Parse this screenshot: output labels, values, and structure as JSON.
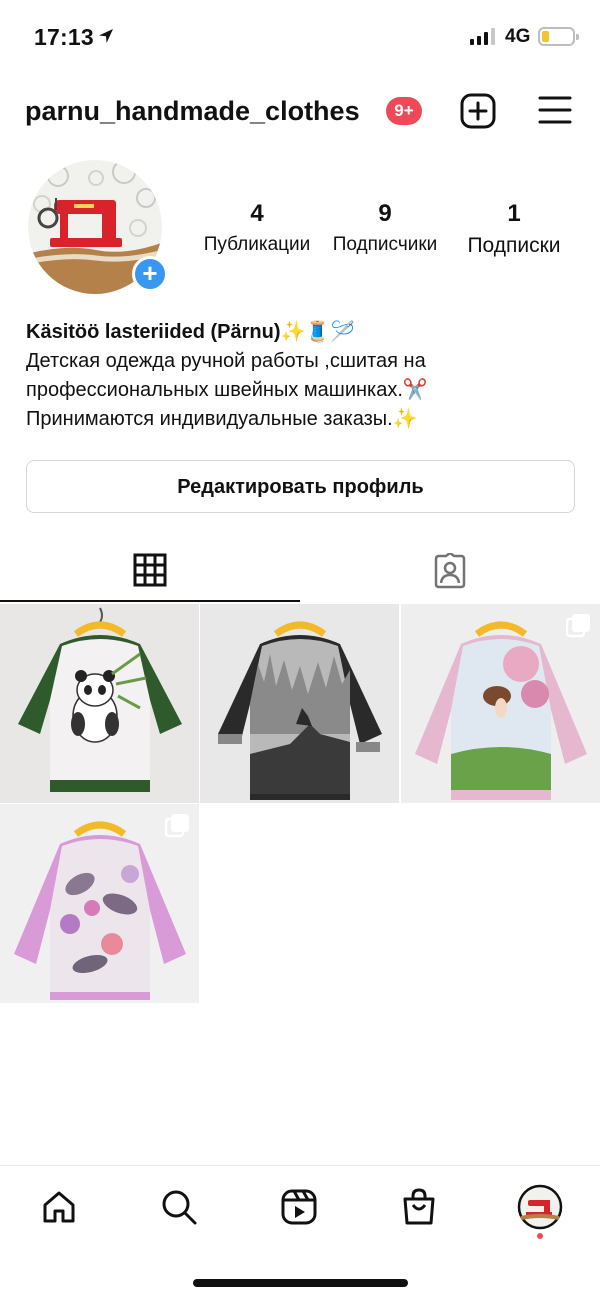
{
  "status_bar": {
    "time": "17:13",
    "network": "4G"
  },
  "header": {
    "username": "parnu_handmade_clothes",
    "notification_badge": "9+"
  },
  "profile": {
    "stats": [
      {
        "value": "4",
        "label": "Публикации"
      },
      {
        "value": "9",
        "label": "Подписчики"
      },
      {
        "value": "1",
        "label": "Подписки"
      }
    ],
    "bio": {
      "name": "Käsitöö lasteriided (Pärnu)✨🧵🪡",
      "line1": "Детская одежда ручной работы ,сшитая на",
      "line2": "профессиональных швейных машинках.✂️",
      "line3": "Принимаются индивидуальные заказы.✨"
    },
    "edit_button": "Редактировать профиль"
  },
  "tabs": [
    {
      "name": "posts-grid",
      "active": true
    },
    {
      "name": "tagged",
      "active": false
    }
  ],
  "posts": [
    {
      "subject": "panda sweatshirt",
      "multiple": false
    },
    {
      "subject": "wolf sweatshirt",
      "multiple": false
    },
    {
      "subject": "fairy dress",
      "multiple": true
    },
    {
      "subject": "floral dress",
      "multiple": true
    }
  ],
  "colors": {
    "badge": "#ed4956",
    "accent_blue": "#3897f0",
    "battery": "#f5c330"
  }
}
